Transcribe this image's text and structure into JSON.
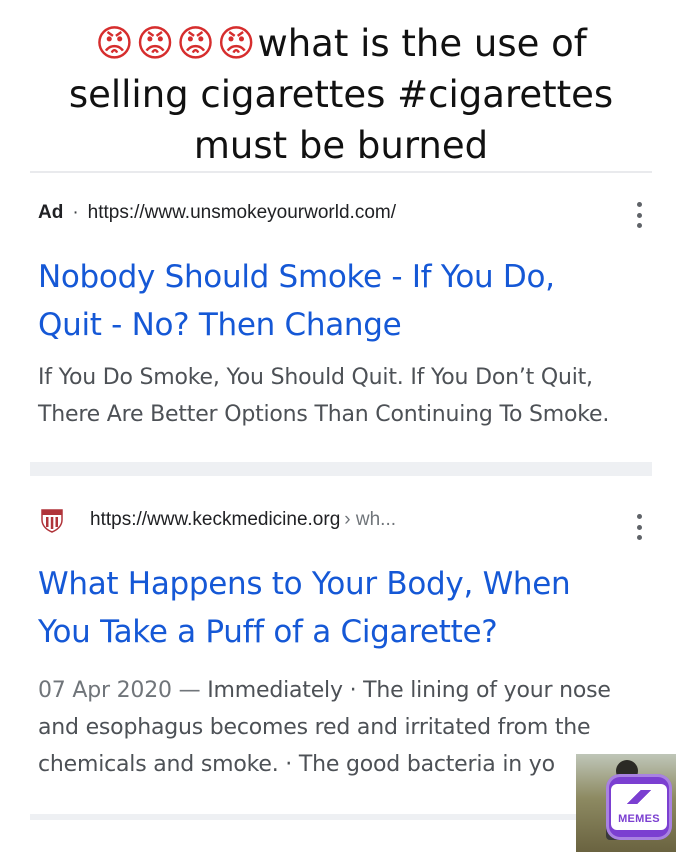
{
  "caption": {
    "emojis": "😡😡😡😡",
    "text_line1": "what is the use of",
    "text_line2": "selling cigarettes #cigarettes",
    "text_line3": "must be burned"
  },
  "results": [
    {
      "ad_label": "Ad",
      "separator": "·",
      "url": "https://www.unsmokeyourworld.com/",
      "title_line1": "Nobody Should Smoke - If You Do,",
      "title_line2": "Quit - No? Then Change",
      "snippet_line1": "If You Do Smoke, You Should Quit. If You Don’t Quit,",
      "snippet_line2": "There Are Better Options Than Continuing To Smoke."
    },
    {
      "url": "https://www.keckmedicine.org",
      "breadcrumb": "› wh...",
      "title_line1": "What Happens to Your Body, When",
      "title_line2": "You Take a Puff of a Cigarette?",
      "date": "07 Apr 2020",
      "dash": " — ",
      "snippet_line1": "Immediately · The lining of your nose",
      "snippet_line2": "and esophagus becomes red and irritated from the",
      "snippet_line3": "chemicals and smoke. · The good bacteria in yo"
    }
  ],
  "watermark": {
    "text": "MEMES"
  },
  "colors": {
    "link": "#1558d6",
    "snippet": "#4d5156",
    "brand": "#7b3fd1"
  }
}
